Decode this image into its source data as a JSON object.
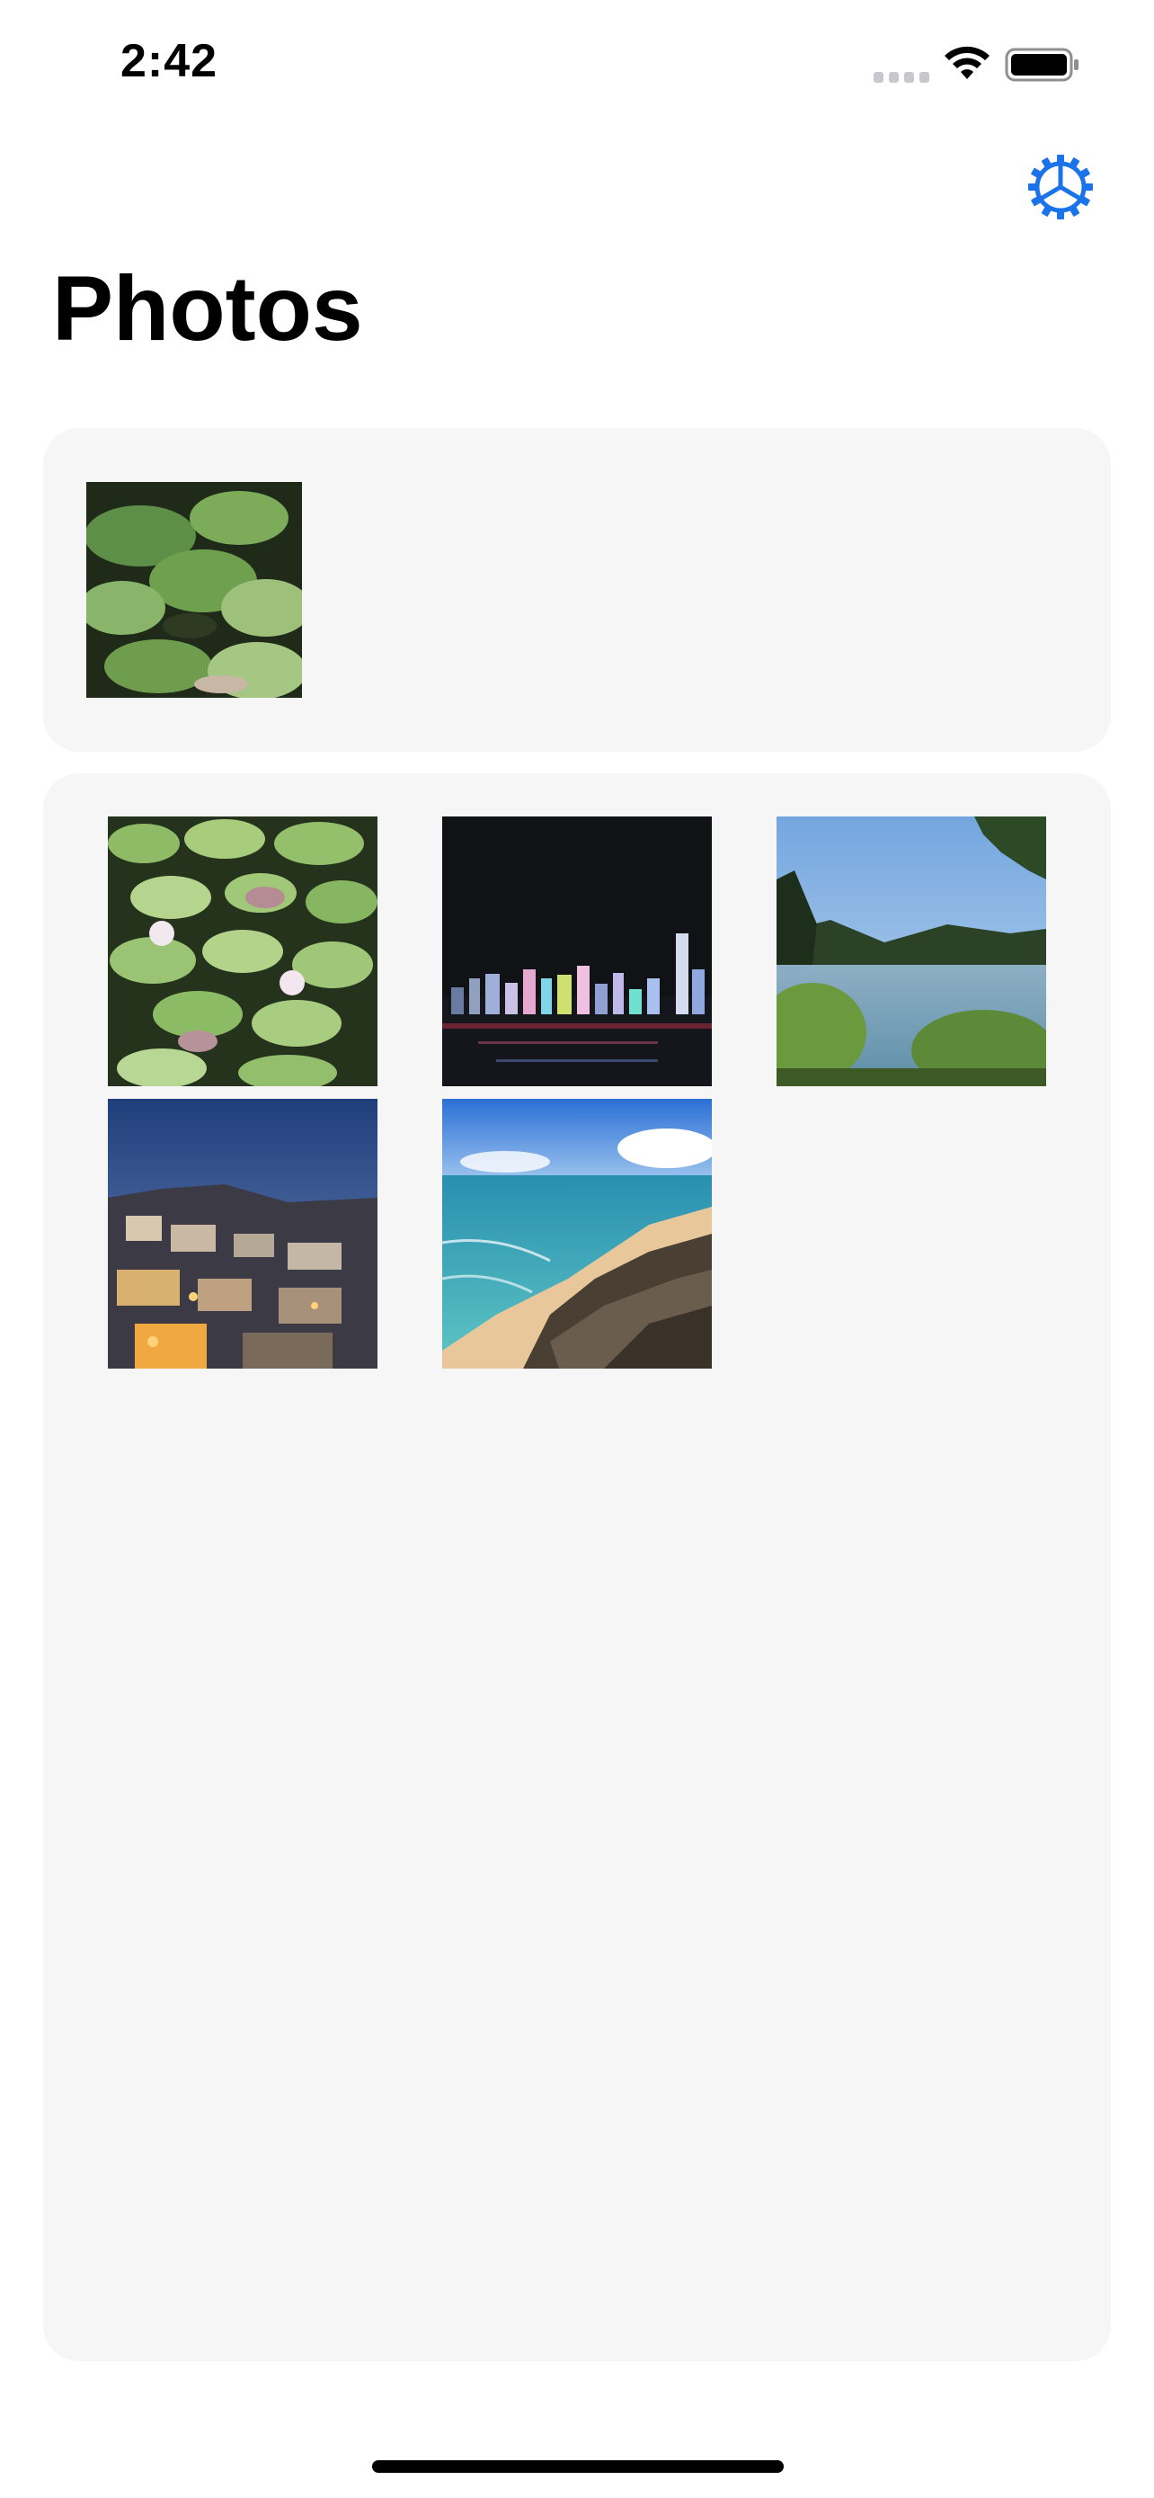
{
  "status_bar": {
    "time": "2:42"
  },
  "header": {
    "title": "Photos",
    "settings_icon": "gear-icon",
    "accent_color": "#1a73e8"
  },
  "featured": {
    "photos": [
      {
        "subject": "water-lilies-closeup"
      }
    ]
  },
  "library": {
    "photos": [
      {
        "subject": "water-lilies-pond"
      },
      {
        "subject": "city-skyline-night"
      },
      {
        "subject": "lake-with-trees"
      },
      {
        "subject": "hillside-town-dusk"
      },
      {
        "subject": "rocky-beach-coast"
      }
    ]
  }
}
